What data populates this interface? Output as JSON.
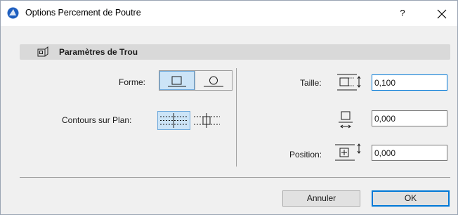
{
  "window": {
    "title": "Options Percement de Poutre",
    "help_label": "?",
    "close_label": "✕",
    "app_icon": "archicad-icon"
  },
  "section": {
    "title": "Paramètres de Trou",
    "icon": "beam-hole-icon"
  },
  "form": {
    "forme_label": "Forme:",
    "forme_options": [
      "rectangular",
      "circular"
    ],
    "forme_selected": "rectangular",
    "contours_label": "Contours sur Plan:",
    "contours_options": [
      "dashed-contour",
      "cut-contour"
    ],
    "contours_selected": "dashed-contour"
  },
  "params": {
    "taille_label": "Taille:",
    "taille_value": "0,100",
    "hauteur_value": "0,000",
    "position_label": "Position:",
    "position_value": "0,000"
  },
  "buttons": {
    "cancel_label": "Annuler",
    "ok_label": "OK"
  },
  "colors": {
    "accent": "#0078d7",
    "selection_bg": "#cce4f7",
    "header_bg": "#d9d9d9",
    "dialog_bg": "#f0f0f0"
  }
}
